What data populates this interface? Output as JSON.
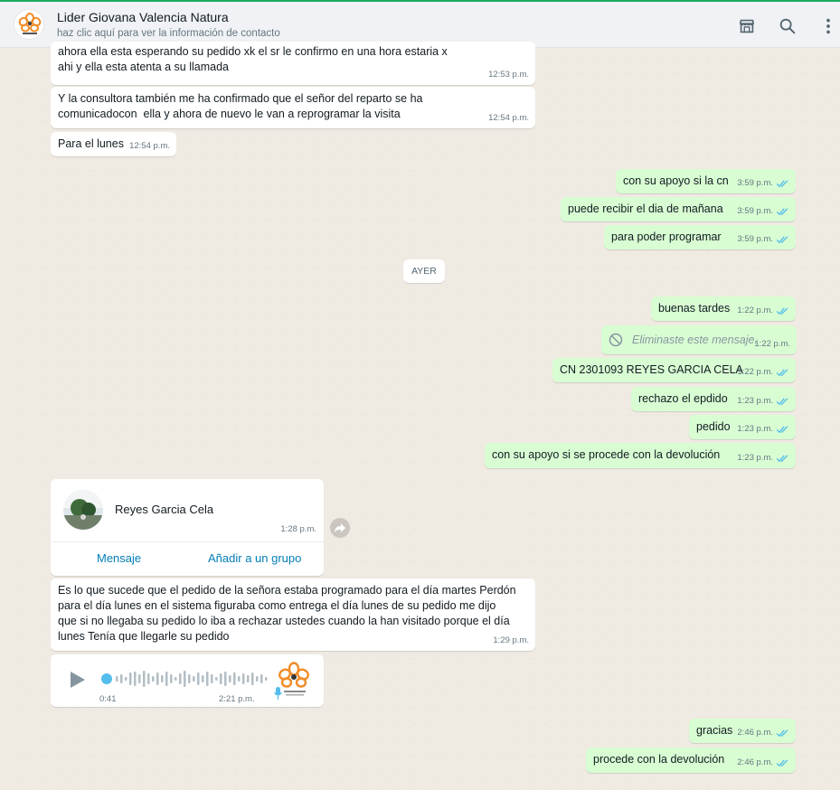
{
  "header": {
    "contact_name": "Lider Giovana Valencia Natura",
    "contact_subtitle": "haz clic aquí para ver la información de contacto",
    "icons": [
      "catalog-icon",
      "search-icon",
      "menu-dots-icon"
    ]
  },
  "colors": {
    "incoming": "#ffffff",
    "outgoing": "#d9fdd3",
    "read_ticks": "#53bdeb",
    "link": "#027eb5",
    "brand_orange": "#f28c28"
  },
  "messages": [
    {
      "dir": "in",
      "text": "ahora ella esta esperando su pedido xk el sr le confirmo en una hora estaria x ahi y ella esta atenta a su llamada",
      "time": "12:53 p.m."
    },
    {
      "dir": "in",
      "text": "Y la consultora también me ha confirmado que el señor del reparto se ha comunicadocon  ella y ahora de nuevo le van a reprogramar la visita",
      "time": "12:54 p.m."
    },
    {
      "dir": "in",
      "text": "Para el lunes",
      "time": "12:54 p.m."
    },
    {
      "dir": "out",
      "text": "con su apoyo si la cn",
      "time": "3:59 p.m."
    },
    {
      "dir": "out",
      "text": "puede recibir el dia de mañana",
      "time": "3:59 p.m."
    },
    {
      "dir": "out",
      "text": "para poder programar",
      "time": "3:59 p.m."
    },
    {
      "dir": "out",
      "text": "buenas tardes",
      "time": "1:22 p.m."
    },
    {
      "dir": "out",
      "text": "Eliminaste este mensaje.",
      "time": "1:22 p.m.",
      "deleted": true
    },
    {
      "dir": "out",
      "text": "CN 2301093 REYES GARCIA CELA",
      "time": "1:22 p.m."
    },
    {
      "dir": "out",
      "text": "rechazo el epdido",
      "time": "1:23 p.m."
    },
    {
      "dir": "out",
      "text": "pedido",
      "time": "1:23 p.m."
    },
    {
      "dir": "out",
      "text": "con su apoyo si se procede con la devolución",
      "time": "1:23 p.m."
    },
    {
      "dir": "in",
      "text": "Es lo que sucede que el pedido de la señora estaba programado para el día martes Perdón para el día lunes en el sistema figuraba como entrega el día lunes de su pedido me dijo que si no llegaba su pedido lo iba a rechazar ustedes cuando la han visitado porque el día lunes Tenía que llegarle su pedido",
      "time": "1:29 p.m."
    },
    {
      "dir": "out",
      "text": "gracias",
      "time": "2:46 p.m."
    },
    {
      "dir": "out",
      "text": "procede con la devolución",
      "time": "2:46 p.m."
    }
  ],
  "day_separator": "AYER",
  "contact_card": {
    "name": "Reyes Garcia Cela",
    "time": "1:28 p.m.",
    "buttons": [
      "Mensaje",
      "Añadir a un grupo"
    ]
  },
  "voice_note": {
    "duration": "0:41",
    "time": "2:21 p.m."
  }
}
